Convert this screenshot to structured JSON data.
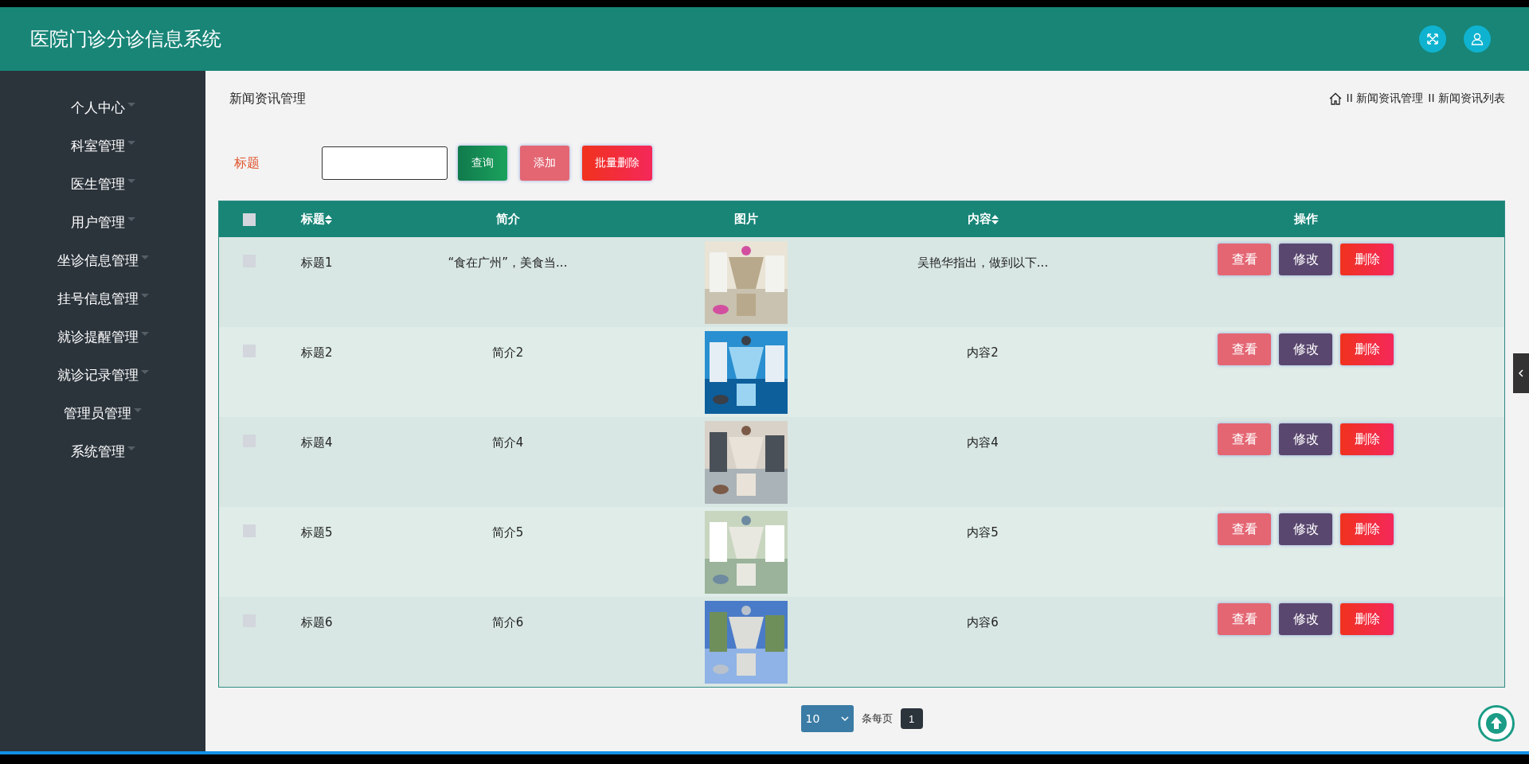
{
  "header": {
    "title": "医院门诊分诊信息系统"
  },
  "sidebar": {
    "items": [
      {
        "label": "个人中心"
      },
      {
        "label": "科室管理"
      },
      {
        "label": "医生管理"
      },
      {
        "label": "用户管理"
      },
      {
        "label": "坐诊信息管理"
      },
      {
        "label": "挂号信息管理"
      },
      {
        "label": "就诊提醒管理"
      },
      {
        "label": "就诊记录管理"
      },
      {
        "label": "管理员管理"
      },
      {
        "label": "系统管理"
      }
    ]
  },
  "page": {
    "title": "新闻资讯管理",
    "breadcrumb": [
      "II 新闻资讯管理",
      "II 新闻资讯列表"
    ]
  },
  "search": {
    "label": "标题",
    "buttons": [
      {
        "kind": "query",
        "label": "查询"
      },
      {
        "kind": "add",
        "label": "添加"
      },
      {
        "kind": "batch_delete",
        "label": "批量删除"
      }
    ]
  },
  "table": {
    "header_checkbox": {
      "checked": false
    },
    "columns": [
      {
        "label": "标题",
        "sortable": true
      },
      {
        "label": "简介",
        "sortable": false
      },
      {
        "label": "图片",
        "sortable": false
      },
      {
        "label": "内容",
        "sortable": true
      },
      {
        "label": "操作",
        "sortable": false
      }
    ],
    "rows": [
      {
        "checked": false,
        "title": "标题1",
        "intro": "“食在广州”，美食当...",
        "content": "吴艳华指出，做到以下...",
        "actions": [
          {
            "kind": "view",
            "label": "查看"
          },
          {
            "kind": "edit",
            "label": "修改"
          },
          {
            "kind": "delete",
            "label": "删除"
          }
        ]
      },
      {
        "checked": false,
        "title": "标题2",
        "intro": "简介2",
        "content": "内容2",
        "actions": [
          {
            "kind": "view",
            "label": "查看"
          },
          {
            "kind": "edit",
            "label": "修改"
          },
          {
            "kind": "delete",
            "label": "删除"
          }
        ]
      },
      {
        "checked": false,
        "title": "标题4",
        "intro": "简介4",
        "content": "内容4",
        "actions": [
          {
            "kind": "view",
            "label": "查看"
          },
          {
            "kind": "edit",
            "label": "修改"
          },
          {
            "kind": "delete",
            "label": "删除"
          }
        ]
      },
      {
        "checked": false,
        "title": "标题5",
        "intro": "简介5",
        "content": "内容5",
        "actions": [
          {
            "kind": "view",
            "label": "查看"
          },
          {
            "kind": "edit",
            "label": "修改"
          },
          {
            "kind": "delete",
            "label": "删除"
          }
        ]
      },
      {
        "checked": false,
        "title": "标题6",
        "intro": "简介6",
        "content": "内容6",
        "actions": [
          {
            "kind": "view",
            "label": "查看"
          },
          {
            "kind": "edit",
            "label": "修改"
          },
          {
            "kind": "delete",
            "label": "删除"
          }
        ]
      }
    ]
  },
  "pagination": {
    "page_size": "10",
    "page_size_label": "条每页",
    "pages": [
      {
        "label": "1",
        "selected": true
      }
    ]
  }
}
